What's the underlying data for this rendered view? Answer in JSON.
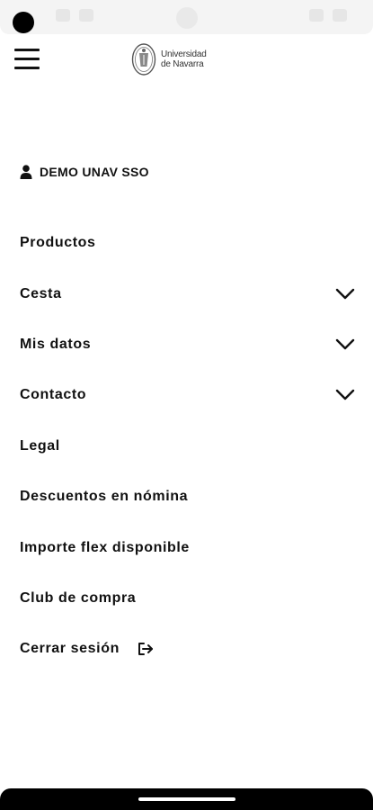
{
  "header": {
    "logo": {
      "line1": "Universidad",
      "line2": "de Navarra",
      "icon": "university-seal"
    },
    "menu_icon": "hamburger-menu-icon"
  },
  "user": {
    "name": "DEMO UNAV SSO",
    "icon": "user-icon"
  },
  "menu": {
    "items": [
      {
        "label": "Productos"
      },
      {
        "label": "Cesta",
        "icon": "chevron-down-icon"
      },
      {
        "label": "Mis datos",
        "icon": "chevron-down-icon"
      },
      {
        "label": "Contacto",
        "icon": "chevron-down-icon"
      },
      {
        "label": "Legal"
      },
      {
        "label": "Descuentos en nómina"
      },
      {
        "label": "Importe flex disponible"
      },
      {
        "label": "Club de compra"
      },
      {
        "label": "Cerrar sesión",
        "icon": "logout-icon"
      }
    ]
  },
  "colors": {
    "text": "#111111",
    "background": "#ffffff",
    "nav_bar": "#000000"
  }
}
